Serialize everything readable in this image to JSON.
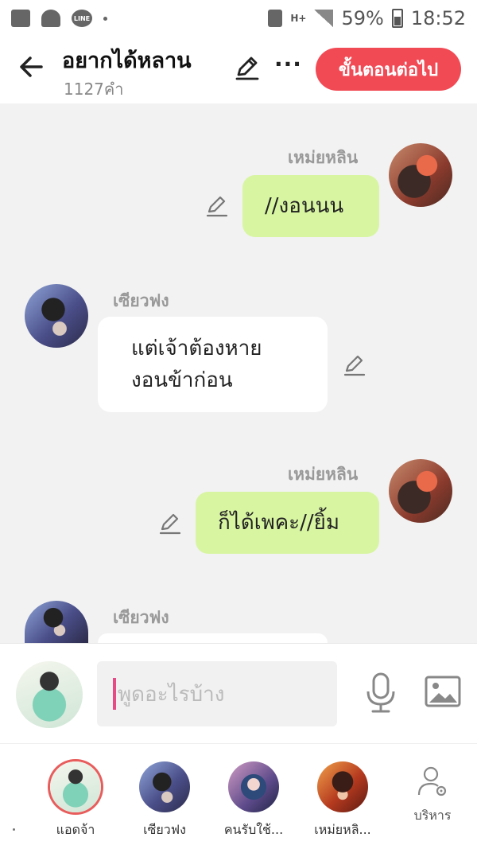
{
  "status_bar": {
    "battery": "59%",
    "time": "18:52",
    "network": "H+",
    "icons": [
      "gallery-icon",
      "add-contact-icon",
      "line-app-icon",
      "notification-dot-icon",
      "storage-icon",
      "signal-icon",
      "battery-icon"
    ]
  },
  "header": {
    "title": "อยากได้หลาน",
    "subtitle": "1127คำ",
    "next_label": "ขั้นตอนต่อไป",
    "more": "···"
  },
  "messages": [
    {
      "side": "me",
      "sender": "เหม่ยหลิน",
      "text": "//งอนนน"
    },
    {
      "side": "other",
      "sender": "เซียวฟง",
      "text_lines": [
        "แต่เจ้าต้องหาย",
        "งอนข้าก่อน"
      ]
    },
    {
      "side": "me",
      "sender": "เหม่ยหลิน",
      "text": "ก็ได้เพคะ//ยิ้ม"
    },
    {
      "side": "other",
      "sender": "เซียวฟง",
      "text": ""
    }
  ],
  "input": {
    "placeholder": "พูดอะไรบ้าง"
  },
  "members": [
    {
      "label": "แอดจ้า",
      "selected": true
    },
    {
      "label": "เซียวฟง",
      "selected": false
    },
    {
      "label": "คนรับใช้...",
      "selected": false
    },
    {
      "label": "เหม่ยหลิ...",
      "selected": false
    }
  ],
  "manage_label": "บริหาร",
  "colors": {
    "accent": "#f24a55",
    "my_bubble": "#d8f5a2",
    "other_bubble": "#ffffff",
    "cursor": "#e84a86"
  }
}
